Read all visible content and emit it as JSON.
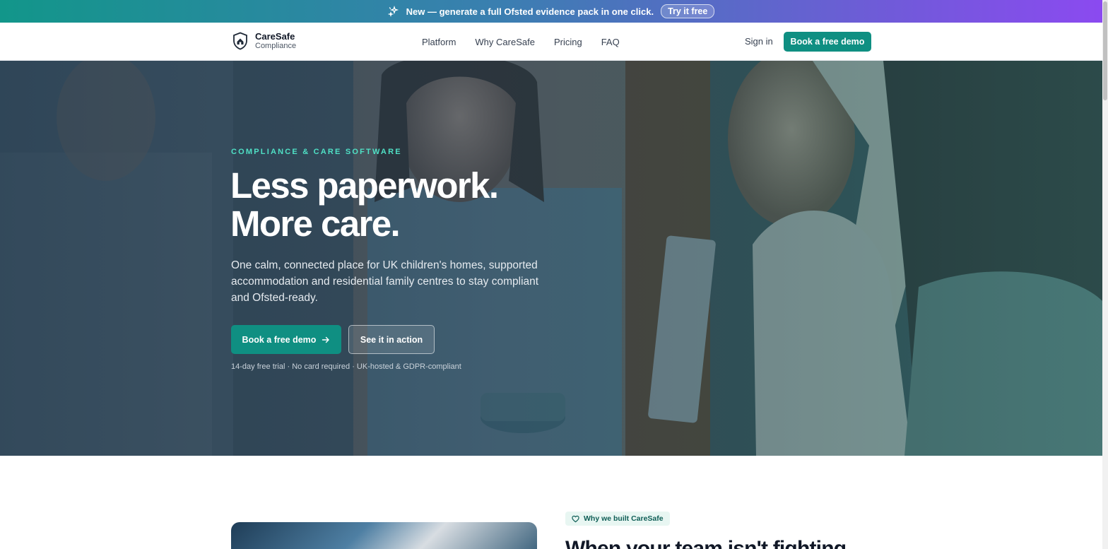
{
  "announcement": {
    "icon": "sparkle-icon",
    "text": "New — generate a full Ofsted evidence pack in one click.",
    "cta_label": "Try it free"
  },
  "nav": {
    "brand_name": "CareSafe",
    "brand_sub": "Compliance",
    "links": [
      "Platform",
      "Why CareSafe",
      "Pricing",
      "FAQ"
    ],
    "signin_label": "Sign in",
    "demo_label": "Book a free demo"
  },
  "hero": {
    "eyebrow": "COMPLIANCE & CARE SOFTWARE",
    "headline_line1": "Less paperwork.",
    "headline_line2": "More care.",
    "lede": "One calm, connected place for UK children's homes, supported accommodation and residential family centres to stay compliant and Ofsted-ready.",
    "cta_primary": "Book a free demo",
    "cta_secondary": "See it in action",
    "trust_line": "14-day free trial · No card required · UK-hosted & GDPR-compliant"
  },
  "why": {
    "badge": "Why we built CareSafe",
    "title": "When your team isn't fighting"
  },
  "colors": {
    "accent": "#0f8f82",
    "eyebrow": "#4fe0c5",
    "announce_gradient_start": "#12968a",
    "announce_gradient_end": "#8b4af0"
  }
}
